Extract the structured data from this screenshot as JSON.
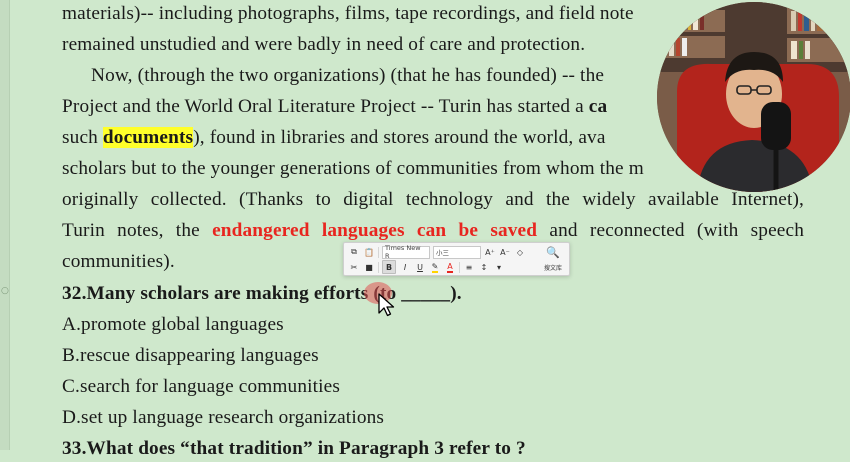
{
  "passage": {
    "line1": "materials)-- including photographs, films, tape recordings, and field note",
    "line2": "remained unstudied and were badly in need of care and protection.",
    "line3": "Now, (through the two organizations) (that he has founded) -- the",
    "line4_pre": "Project and the World Oral Literature Project -- Turin has started a ",
    "line4_bold": "ca",
    "line5_pre": "such ",
    "line5_highlight": "documents",
    "line5_post": "), found in libraries and stores around the world, ava",
    "line6": "scholars but to the younger generations of communities from whom the m",
    "line7": "originally collected. (Thanks to digital technology and the widely available Internet),",
    "line8_pre": "Turin notes, the ",
    "line8_red": "endangered languages can be saved",
    "line8_post": " and reconnected (with speech",
    "line9": "communities)."
  },
  "question32": {
    "title": "32.Many scholars are making efforts (to _____).",
    "options": [
      "A.promote global languages",
      "B.rescue disappearing languages",
      "C.search for language communities",
      "D.set up language research organizations"
    ]
  },
  "question33": {
    "title": "33.What does “that tradition” in Paragraph 3 refer to ?"
  },
  "mini_toolbar": {
    "font_name": "Times New R",
    "font_size": "小三",
    "grow_font": "A⁺",
    "shrink_font": "A⁻",
    "bold": "B",
    "italic": "I",
    "underline": "U",
    "more": "▾",
    "font_color": "A",
    "lookup_label": "搜文库"
  },
  "colors": {
    "background": "#cfe8cc",
    "highlight": "#ffff2a",
    "emphasis_red": "#e8251f"
  }
}
